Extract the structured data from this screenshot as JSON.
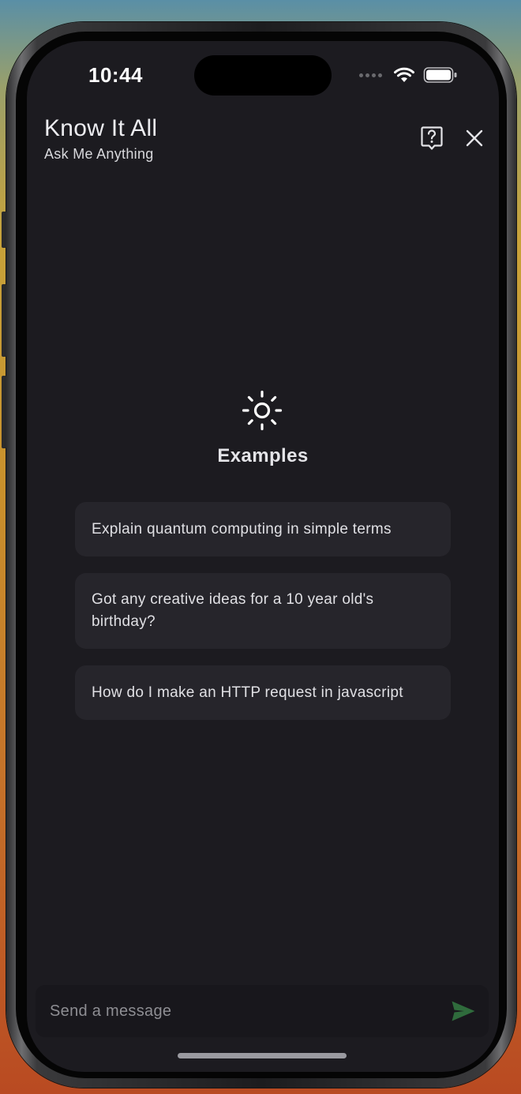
{
  "status_bar": {
    "time": "10:44"
  },
  "header": {
    "title": "Know It All",
    "subtitle": "Ask Me Anything",
    "help_icon": "question-bubble-icon",
    "close_icon": "close-icon"
  },
  "examples": {
    "icon": "sun-icon",
    "heading": "Examples",
    "items": [
      "Explain quantum computing in simple terms",
      "Got any creative ideas for a 10 year old's birthday?",
      "How do I make an HTTP request in javascript"
    ]
  },
  "composer": {
    "placeholder": "Send a message",
    "value": "",
    "send_icon": "send-icon",
    "send_color": "#2f6b3c"
  },
  "colors": {
    "screen_background": "#1c1b20",
    "card_background": "#26252b",
    "text_primary": "#ececf0"
  }
}
